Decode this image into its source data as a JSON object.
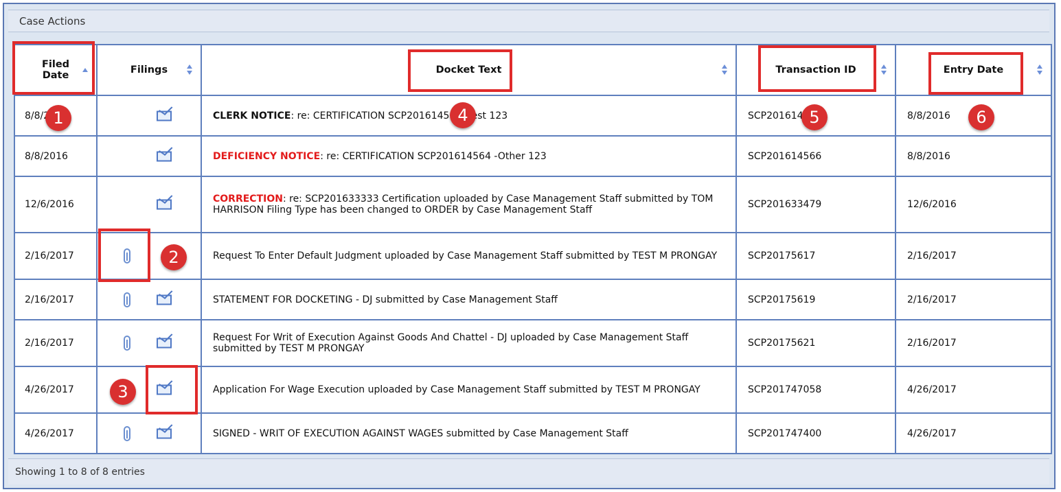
{
  "panel": {
    "title": "Case Actions",
    "footer": "Showing 1 to 8 of 8 entries"
  },
  "columns": {
    "filed_date": "Filed Date",
    "filings": "Filings",
    "docket_text": "Docket Text",
    "transaction_id": "Transaction ID",
    "entry_date": "Entry Date"
  },
  "rows": [
    {
      "filed_date": "8/8/2016",
      "docket_prefix": "CLERK NOTICE",
      "docket_text": ": re: CERTIFICATION SCP201614564 -Test 123",
      "transaction_id": "SCP201614565",
      "entry_date": "8/8/2016",
      "has_clip": false,
      "has_mail": true
    },
    {
      "filed_date": "8/8/2016",
      "docket_prefix": "DEFICIENCY NOTICE",
      "docket_text": ": re: CERTIFICATION SCP201614564 -Other 123",
      "transaction_id": "SCP201614566",
      "entry_date": "8/8/2016",
      "has_clip": false,
      "has_mail": true
    },
    {
      "filed_date": "12/6/2016",
      "docket_prefix": "CORRECTION",
      "docket_text": ": re: SCP201633333 Certification uploaded by Case Management Staff submitted by TOM HARRISON Filing Type has been changed to ORDER by Case Management Staff",
      "transaction_id": "SCP201633479",
      "entry_date": "12/6/2016",
      "has_clip": false,
      "has_mail": true
    },
    {
      "filed_date": "2/16/2017",
      "docket_prefix": "",
      "docket_text": "Request To Enter Default Judgment uploaded by Case Management Staff submitted by TEST M PRONGAY",
      "transaction_id": "SCP20175617",
      "entry_date": "2/16/2017",
      "has_clip": true,
      "has_mail": false
    },
    {
      "filed_date": "2/16/2017",
      "docket_prefix": "",
      "docket_text": "STATEMENT FOR DOCKETING - DJ submitted by Case Management Staff",
      "transaction_id": "SCP20175619",
      "entry_date": "2/16/2017",
      "has_clip": true,
      "has_mail": true
    },
    {
      "filed_date": "2/16/2017",
      "docket_prefix": "",
      "docket_text": "Request For Writ of Execution Against Goods And Chattel - DJ uploaded by Case Management Staff submitted by TEST M PRONGAY",
      "transaction_id": "SCP20175621",
      "entry_date": "2/16/2017",
      "has_clip": true,
      "has_mail": true
    },
    {
      "filed_date": "4/26/2017",
      "docket_prefix": "",
      "docket_text": "Application For Wage Execution uploaded by Case Management Staff submitted by TEST M PRONGAY",
      "transaction_id": "SCP201747058",
      "entry_date": "4/26/2017",
      "has_clip": false,
      "has_mail": true
    },
    {
      "filed_date": "4/26/2017",
      "docket_prefix": "",
      "docket_text": "SIGNED - WRIT OF EXECUTION AGAINST WAGES submitted by Case Management Staff",
      "transaction_id": "SCP201747400",
      "entry_date": "4/26/2017",
      "has_clip": true,
      "has_mail": true
    }
  ],
  "callouts": [
    "1",
    "2",
    "3",
    "4",
    "5",
    "6"
  ],
  "colors": {
    "border": "#5e7fbd",
    "callout": "#d93030",
    "notice_red": "#e31b1b"
  }
}
